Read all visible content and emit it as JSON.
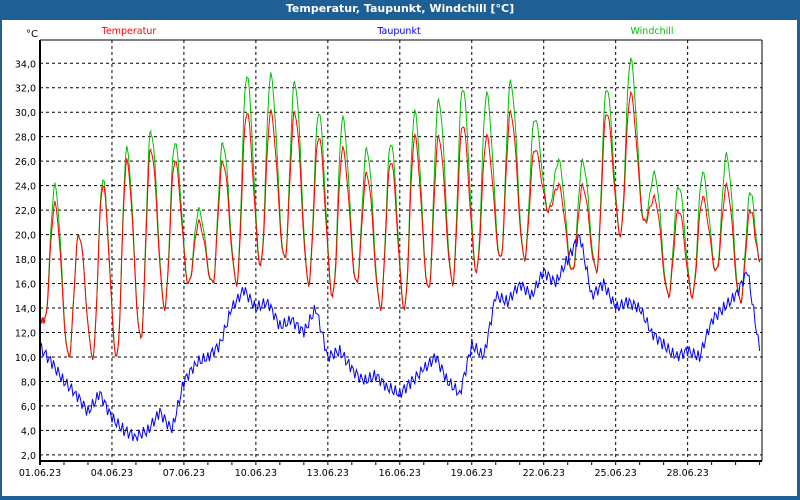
{
  "window": {
    "title": "Temperatur, Taupunkt, Windchill [°C]"
  },
  "chart_data": {
    "type": "line",
    "title": "Temperatur, Taupunkt, Windchill [°C]",
    "ylabel": "°C",
    "xlabel": "",
    "ylim": [
      1.5,
      35.9
    ],
    "xlim_days": [
      0,
      30.1
    ],
    "yticks": [
      "2,0",
      "4,0",
      "6,0",
      "8,0",
      "10,0",
      "12,0",
      "14,0",
      "16,0",
      "18,0",
      "20,0",
      "22,0",
      "24,0",
      "26,0",
      "28,0",
      "30,0",
      "32,0",
      "34,0"
    ],
    "xticks": [
      "01.06.23",
      "04.06.23",
      "07.06.23",
      "10.06.23",
      "13.06.23",
      "16.06.23",
      "19.06.23",
      "22.06.23",
      "25.06.23",
      "28.06.23"
    ],
    "grid": true,
    "legend_placement": "top",
    "series": [
      {
        "name": "Temperatur",
        "color": "#ff0000",
        "daily_min": [
          13,
          10,
          10,
          10,
          11.5,
          14,
          16,
          16,
          16,
          17.5,
          18,
          16,
          15,
          16,
          14,
          14,
          15.5,
          16,
          17,
          18,
          18,
          22,
          17,
          17,
          20,
          21,
          15,
          15,
          17,
          14.5
        ],
        "daily_max": [
          22.5,
          20,
          24,
          26,
          27,
          26,
          21,
          26,
          30,
          30,
          30,
          28,
          27,
          25,
          26,
          28,
          28,
          29,
          28,
          30,
          27,
          24,
          24,
          30,
          31.5,
          23,
          22,
          23,
          24,
          22
        ],
        "end_value": 18
      },
      {
        "name": "Taupunkt",
        "color": "#0000ff",
        "values_12h": [
          10.8,
          9.5,
          8,
          7,
          5.5,
          7,
          5,
          4,
          3.5,
          4,
          5.5,
          4,
          8,
          9.5,
          10,
          11,
          14,
          15.5,
          14,
          14.5,
          12.5,
          13,
          12,
          14,
          10,
          10.5,
          9,
          8,
          8.5,
          7.5,
          7,
          8,
          9,
          10,
          8,
          7,
          11,
          10,
          15,
          14.5,
          16,
          15,
          17,
          16,
          18,
          20,
          15,
          16,
          14,
          14.5,
          14,
          12,
          11,
          10,
          10.5,
          10,
          13,
          14,
          15,
          17,
          10.5
        ]
      },
      {
        "name": "Windchill",
        "color": "#00c000",
        "daily_min": [
          13,
          10,
          10,
          10,
          11.5,
          14,
          16,
          16,
          16,
          17.5,
          18,
          16,
          15,
          16,
          14,
          14,
          15.5,
          16,
          17,
          18,
          18,
          22,
          17,
          17,
          20,
          21,
          15,
          15,
          17,
          14.5
        ],
        "daily_max": [
          24,
          20,
          24.5,
          27,
          28.5,
          27.5,
          22,
          27.5,
          33,
          33,
          32.5,
          30,
          29.5,
          27,
          27.5,
          30,
          31,
          32,
          31.5,
          32.5,
          29.5,
          26,
          26,
          32,
          34.3,
          25,
          24,
          25,
          26.5,
          23.5
        ],
        "end_value": 18
      }
    ]
  }
}
